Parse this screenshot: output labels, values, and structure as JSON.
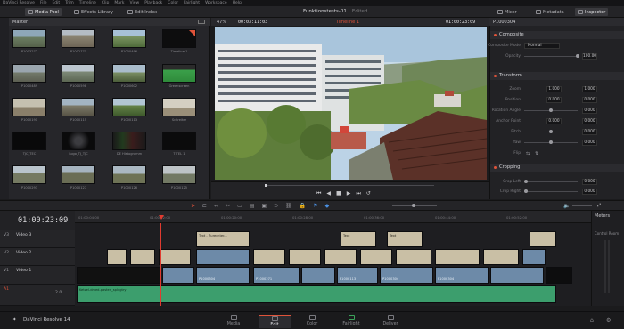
{
  "menu": [
    "DaVinci Resolve",
    "File",
    "Edit",
    "Trim",
    "Timeline",
    "Clip",
    "Mark",
    "View",
    "Playback",
    "Color",
    "Fairlight",
    "Workspace",
    "Help"
  ],
  "topbar": {
    "media_pool": "Media Pool",
    "effects_library": "Effects Library",
    "edit_index": "Edit Index",
    "project_title": "Funktionstests-01",
    "edited": "Edited",
    "mixer": "Mixer",
    "metadata": "Metadata",
    "inspector": "Inspector"
  },
  "media_pool": {
    "bin": "Master",
    "clips": [
      "P1003272",
      "P1002771",
      "P1000496",
      "Timeline 1",
      "P1000489",
      "P1000598",
      "P1000602",
      "Greenscreen",
      "P1000191",
      "P1000115",
      "P1000113",
      "Schreiter",
      "TJC_TEC",
      "Logo_TJ_TJC",
      "DE Histogramm",
      "TITEL 1",
      "P1000293",
      "P1000127",
      "P1000126",
      "P1000125"
    ]
  },
  "viewer": {
    "zoom": "47%",
    "source_tc": "00:03:11:03",
    "timeline_name": "Timeline 1",
    "record_tc": "01:00:23:09",
    "clip_name": "P1000304"
  },
  "inspector": {
    "composite": "Composite",
    "composite_mode_label": "Composite Mode",
    "composite_mode": "Normal",
    "opacity_label": "Opacity",
    "opacity": "100.00",
    "transform": "Transform",
    "zoom_label": "Zoom",
    "zoom_x": "1.000",
    "zoom_y": "1.000",
    "position_label": "Position",
    "pos_x": "0.000",
    "pos_y": "0.000",
    "rotation_label": "Rotation Angle",
    "rotation": "0.000",
    "anchor_label": "Anchor Point",
    "anchor_x": "0.000",
    "anchor_y": "0.000",
    "pitch_label": "Pitch",
    "pitch": "0.000",
    "yaw_label": "Yaw",
    "yaw": "0.000",
    "flip_label": "Flip",
    "cropping": "Cropping",
    "crop_left_label": "Crop Left",
    "crop_left": "0.000",
    "crop_right_label": "Crop Right",
    "crop_right": "0.000"
  },
  "timeline": {
    "timecode": "01:00:23:09",
    "ruler": [
      "01:00:04:00",
      "01:00:12:00",
      "01:00:20:00",
      "01:00:28:00",
      "01:00:36:00",
      "01:00:44:00",
      "01:00:52:00"
    ],
    "tracks": {
      "v3": {
        "id": "V3",
        "name": "Video 3"
      },
      "v2": {
        "id": "V2",
        "name": "Video 2"
      },
      "v1": {
        "id": "V1",
        "name": "Video 1"
      },
      "a1": {
        "id": "A1",
        "name": "Audio 1",
        "level": "2.0"
      }
    },
    "clips_v3": [
      "Text - Zurechter...",
      "Text",
      "Text"
    ],
    "clips_v1": [
      "P1000304",
      "P1000271",
      "P1000113",
      "P1000304",
      "P1000304"
    ],
    "audio_clip": "Ketzel-dmed-pasten_splugtry",
    "meters_title": "Meters",
    "control_room": "Control Room"
  },
  "pages": [
    "Media",
    "Edit",
    "Color",
    "Fairlight",
    "Deliver"
  ],
  "app_name": "DaVinci Resolve 14"
}
